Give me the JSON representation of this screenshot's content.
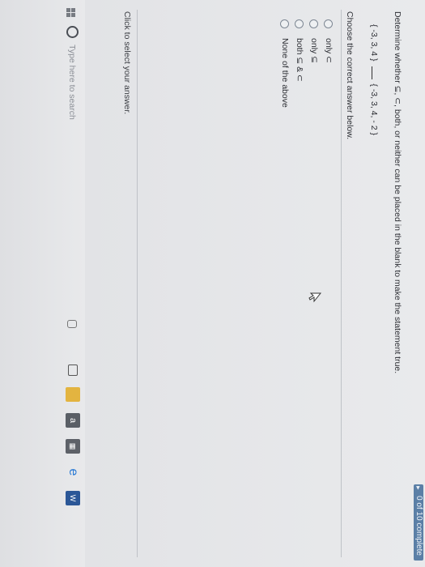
{
  "header": {
    "progress_label": "0 of 10 complete"
  },
  "question": {
    "prompt": "Determine whether ⊆, ⊂, both, or neither can be placed in the blank to make the statement true.",
    "left_set": "{ -3, 3, 4 }",
    "right_set": "{ -3, 3, 4, - 2 }",
    "instruction": "Choose the correct answer below."
  },
  "options": [
    {
      "label": "only ⊂"
    },
    {
      "label": "only ⊆"
    },
    {
      "label": "both ⊆ & ⊂"
    },
    {
      "label": "None of the above"
    }
  ],
  "footer": {
    "hint": "Click to select your answer."
  },
  "taskbar": {
    "search_placeholder": "Type here to search",
    "icons": [
      "windows-start-icon",
      "cortana-icon",
      "microphone-icon",
      "task-view-icon",
      "file-explorer-icon",
      "amazon-icon",
      "store-icon",
      "edge-icon",
      "word-icon"
    ]
  }
}
